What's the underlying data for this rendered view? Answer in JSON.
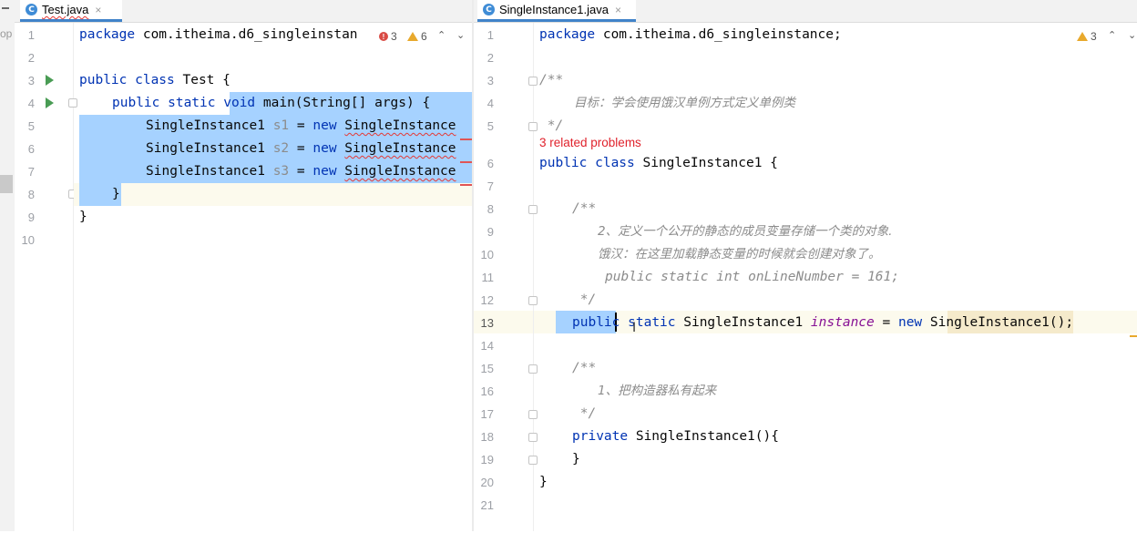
{
  "left_editor": {
    "tab": {
      "label": "Test.java",
      "icon": "c-class-icon",
      "close": "×"
    },
    "inspection": {
      "errors": "3",
      "warnings": "6"
    },
    "line_numbers": [
      "1",
      "2",
      "3",
      "4",
      "5",
      "6",
      "7",
      "8",
      "9",
      "10"
    ],
    "lines": {
      "l1": {
        "kw": "package",
        "rest": " com.itheima.d6_singleinstan"
      },
      "l3": {
        "kw": "public class",
        "name": " Test {"
      },
      "l4": {
        "kw1": "public static",
        "sel_kw": "void",
        "rest": " main(String[] args) {"
      },
      "l5": {
        "type": "SingleInstance1",
        "var": "s1",
        "eq": " = ",
        "kw": "new",
        "call": "SingleInstance"
      },
      "l6": {
        "type": "SingleInstance1",
        "var": "s2",
        "eq": " = ",
        "kw": "new",
        "call": "SingleInstance"
      },
      "l7": {
        "type": "SingleInstance1",
        "var": "s3",
        "eq": " = ",
        "kw": "new",
        "call": "SingleInstance"
      },
      "l8": "}",
      "l9": "}"
    }
  },
  "right_editor": {
    "tab": {
      "label": "SingleInstance1.java",
      "icon": "c-class-icon",
      "close": "×"
    },
    "inspection": {
      "warnings": "3"
    },
    "line_numbers": [
      "1",
      "2",
      "3",
      "4",
      "5",
      "6",
      "7",
      "8",
      "9",
      "10",
      "11",
      "12",
      "13",
      "14",
      "15",
      "16",
      "17",
      "18",
      "19",
      "20",
      "21"
    ],
    "lines": {
      "l1": {
        "kw": "package",
        "rest": " com.itheima.d6_singleinstance;"
      },
      "l3": "/**",
      "l4": "目标：学会使用饿汉单例方式定义单例类",
      "l5": " */",
      "problems": "3 related problems",
      "l6": {
        "kw": "public class",
        "name": " SingleInstance1 {"
      },
      "l8": "/**",
      "l9": "2、定义一个公开的静态的成员变量存储一个类的对象.",
      "l10": "饿汉：在这里加载静态变量的时候就会创建对象了。",
      "l11": "public static int onLineNumber = 161;",
      "l12": " */",
      "l13": {
        "sel": "publi",
        "kw_a": "c",
        "kw_b": "static",
        "type": " SingleInstance1 ",
        "field": "instance",
        "eq": " = ",
        "kw_c": "new",
        "call": "SingleInstance1",
        "end": "();"
      },
      "l15": "/**",
      "l16": "1、把构造器私有起来",
      "l17": " */",
      "l18": {
        "kw": "private",
        "rest": " SingleInstance1(){"
      },
      "l19": "}",
      "l20": "}"
    }
  },
  "edge": {
    "label": "op"
  }
}
